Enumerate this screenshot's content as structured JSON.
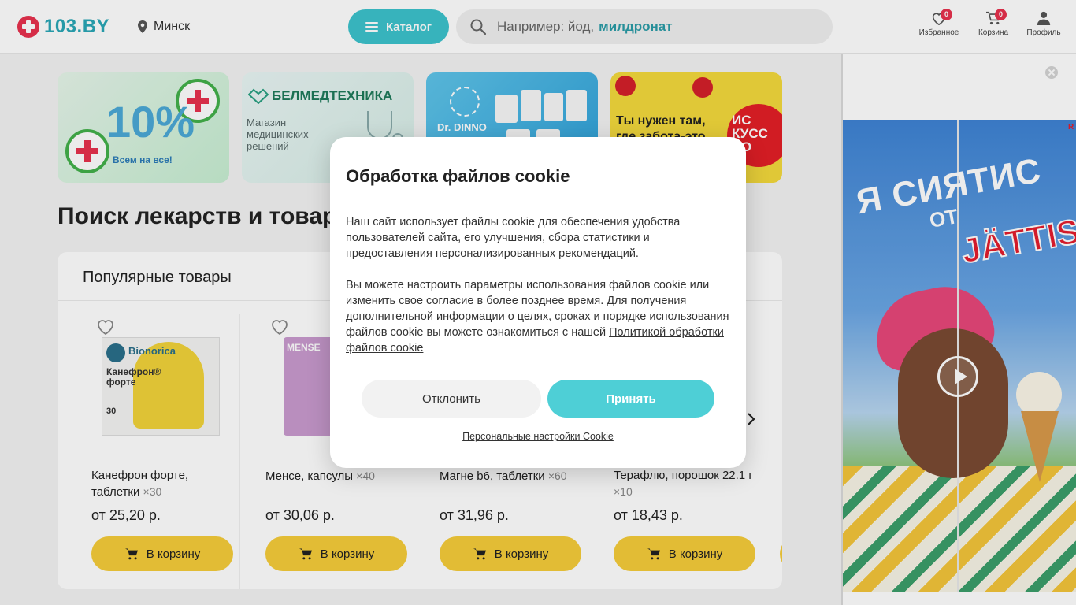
{
  "header": {
    "logo_text": "103.BY",
    "city": "Минск",
    "catalog_label": "Каталог",
    "search_placeholder_1": "Например: йод,",
    "search_placeholder_2": "милдронат",
    "favorites": {
      "label": "Избранное",
      "count": "0"
    },
    "cart": {
      "label": "Корзина",
      "count": "0"
    },
    "profile": {
      "label": "Профиль"
    }
  },
  "banners": [
    {
      "big": "10%",
      "small": "Всем на все!"
    },
    {
      "title": "БЕЛМЕДТЕХНИКА",
      "sub_1": "Магазин",
      "sub_2": "медицинских",
      "sub_3": "решений"
    },
    {
      "brand": "Dr. DINNO"
    },
    {
      "text_1": "Ты нужен там,",
      "text_2": "где забота-это",
      "circle_1": "ИС",
      "circle_2": "КУСС",
      "circle_3": "ВО"
    }
  ],
  "page_title": "Поиск лекарств и товаров",
  "popular": {
    "title": "Популярные товары",
    "products": [
      {
        "name": "Канефрон форте, таблетки",
        "qty": "×30",
        "price": "от 25,20 р.",
        "button": "В корзину",
        "box_brand": "Bionorica",
        "box_title": "Канефрон® форте",
        "box_count": "30"
      },
      {
        "name": "Менсе, капсулы",
        "qty": "×40",
        "price": "от 30,06 р.",
        "button": "В корзину",
        "box_brand": "MENSE"
      },
      {
        "name": "Магне b6, таблетки",
        "qty": "×60",
        "price": "от 31,96 р.",
        "button": "В корзину"
      },
      {
        "name": "Терафлю, порошок 22.1 г",
        "qty": "×10",
        "price": "от 18,43 р.",
        "button": "В корзину"
      }
    ]
  },
  "ad": {
    "headline_1": "Я СИЯТИС",
    "headline_2": "ОТ",
    "brand": "JÄTTIS",
    "mark": "R"
  },
  "cookie_modal": {
    "title": "Обработка файлов cookie",
    "paragraph_1": "Наш сайт использует файлы cookie для обеспечения удобства пользователей сайта, его улучшения, сбора статистики и предоставления персонализированных рекомендаций.",
    "paragraph_2": "Вы можете настроить параметры использования файлов cookie или изменить свое согласие в более позднее время. Для получения дополнительной информации о целях, сроках и порядке использования файлов cookie вы можете ознакомиться с нашей",
    "policy_link": "Политикой обработки файлов cookie",
    "decline_label": "Отклонить",
    "accept_label": "Принять",
    "settings_link": "Персональные настройки Cookie"
  },
  "colors": {
    "brand_red": "#e8314e",
    "brand_teal": "#3cc3cc",
    "accept": "#4ecfd6",
    "cart_button": "#f6cc3a"
  }
}
